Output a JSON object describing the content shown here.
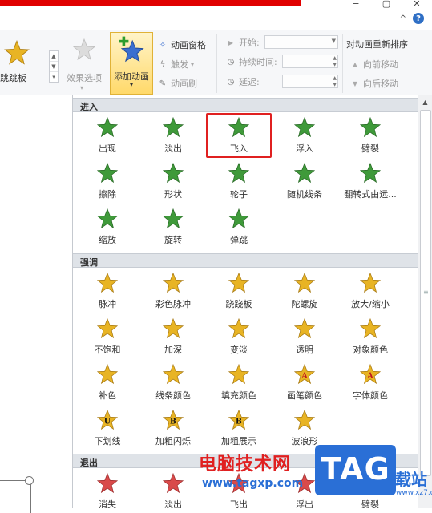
{
  "window": {
    "controls": [
      "−",
      "▢",
      "✕"
    ],
    "collapse_ribbon": "^",
    "help": "?"
  },
  "ribbon": {
    "partial_effect_label": "跳跳板",
    "effect_options_label": "效果选项",
    "add_animation_label": "添加动画",
    "animation_pane_label": "动画窗格",
    "trigger_label": "触发",
    "animation_painter_label": "动画刷",
    "start_label": "开始:",
    "duration_label": "持续时间:",
    "delay_label": "延迟:",
    "reorder_title": "对动画重新排序",
    "move_earlier_label": "向前移动",
    "move_later_label": "向后移动"
  },
  "gallery": {
    "entrance": {
      "title": "进入",
      "items": [
        {
          "label": "出现",
          "icon": "star-appear-icon",
          "highlight": false
        },
        {
          "label": "淡出",
          "icon": "star-fade-icon",
          "highlight": false
        },
        {
          "label": "飞入",
          "icon": "star-fly-in-icon",
          "highlight": true
        },
        {
          "label": "浮入",
          "icon": "star-float-in-icon",
          "highlight": false
        },
        {
          "label": "劈裂",
          "icon": "star-split-icon",
          "highlight": false
        },
        {
          "label": "擦除",
          "icon": "star-wipe-icon",
          "highlight": false
        },
        {
          "label": "形状",
          "icon": "star-shape-icon",
          "highlight": false
        },
        {
          "label": "轮子",
          "icon": "star-wheel-icon",
          "highlight": false
        },
        {
          "label": "随机线条",
          "icon": "star-random-bars-icon",
          "highlight": false
        },
        {
          "label": "翻转式由远...",
          "icon": "star-grow-turn-icon",
          "highlight": false
        },
        {
          "label": "缩放",
          "icon": "star-zoom-icon",
          "highlight": false
        },
        {
          "label": "旋转",
          "icon": "star-swivel-icon",
          "highlight": false
        },
        {
          "label": "弹跳",
          "icon": "star-bounce-icon",
          "highlight": false
        }
      ]
    },
    "emphasis": {
      "title": "强调",
      "items": [
        {
          "label": "脉冲",
          "icon": "star-pulse-icon"
        },
        {
          "label": "彩色脉冲",
          "icon": "star-color-pulse-icon"
        },
        {
          "label": "跷跷板",
          "icon": "star-teeter-icon"
        },
        {
          "label": "陀螺旋",
          "icon": "star-spin-icon"
        },
        {
          "label": "放大/缩小",
          "icon": "star-grow-shrink-icon"
        },
        {
          "label": "不饱和",
          "icon": "star-desaturate-icon"
        },
        {
          "label": "加深",
          "icon": "star-darken-icon"
        },
        {
          "label": "变淡",
          "icon": "star-lighten-icon"
        },
        {
          "label": "透明",
          "icon": "star-transparency-icon"
        },
        {
          "label": "对象颜色",
          "icon": "star-object-color-icon"
        },
        {
          "label": "补色",
          "icon": "star-complementary-color-icon"
        },
        {
          "label": "线条颜色",
          "icon": "star-line-color-icon"
        },
        {
          "label": "填充颜色",
          "icon": "star-fill-color-icon"
        },
        {
          "label": "画笔颜色",
          "icon": "star-brush-color-icon",
          "glyph": "A"
        },
        {
          "label": "字体颜色",
          "icon": "star-font-color-icon",
          "glyph": "A"
        },
        {
          "label": "下划线",
          "icon": "star-underline-icon",
          "glyph": "U"
        },
        {
          "label": "加粗闪烁",
          "icon": "star-bold-flash-icon",
          "glyph": "B"
        },
        {
          "label": "加粗展示",
          "icon": "star-bold-reveal-icon",
          "glyph": "B"
        },
        {
          "label": "波浪形",
          "icon": "star-wave-icon"
        }
      ]
    },
    "exit": {
      "title": "退出",
      "items": [
        {
          "label": "消失",
          "icon": "star-disappear-icon"
        },
        {
          "label": "淡出",
          "icon": "star-fade-out-icon"
        },
        {
          "label": "飞出",
          "icon": "star-fly-out-icon"
        },
        {
          "label": "浮出",
          "icon": "star-float-out-icon"
        },
        {
          "label": "劈裂",
          "icon": "star-split-out-icon"
        }
      ]
    }
  },
  "watermark": {
    "text": "电脑技术网",
    "url": "www.tagxp.com",
    "logo": "TAG",
    "side_text": "载站",
    "side_url": "www.xz7.com"
  },
  "colors": {
    "entrance_star": "#3f9a3a",
    "emphasis_star": "#e8b424",
    "exit_star": "#d94a4a",
    "highlight_border": "#e02020",
    "add_animation_bg": "#ffd96a"
  }
}
